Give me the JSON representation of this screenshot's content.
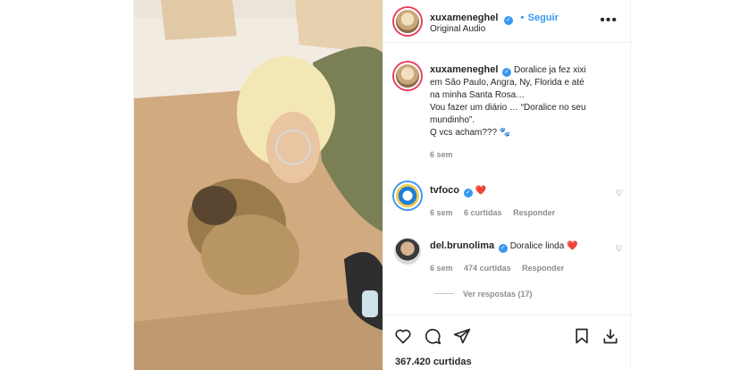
{
  "header": {
    "username": "xuxameneghel",
    "follow_label": "Seguir",
    "audio": "Original Audio",
    "more_label": "•••"
  },
  "caption": {
    "username": "xuxameneghel",
    "line1": "Doralice ja fez xixi",
    "line2": "em São Paulo, Angra, Ny, Florida e até",
    "line3": "na minha Santa Rosa…",
    "line4": "Vou fazer um diário … “Doralice no seu",
    "line5": "mundinho”.",
    "line6": "Q vcs acham??? 🐾",
    "time": "6 sem"
  },
  "comments": [
    {
      "username": "tvfoco",
      "text": "❤️",
      "time": "6 sem",
      "likes": "6 curtidas",
      "reply": "Responder"
    },
    {
      "username": "del.brunolima",
      "text": "Doralice linda ❤️",
      "time": "6 sem",
      "likes": "474 curtidas",
      "reply": "Responder"
    }
  ],
  "view_replies": "Ver respostas (17)",
  "likes_count": "367.420 curtidas",
  "icons": [
    "heart-icon",
    "comment-icon",
    "share-icon",
    "save-icon",
    "download-icon"
  ],
  "colors": {
    "verified": "#3897f0",
    "follow": "#3897f0",
    "heart": "#ed4956"
  }
}
